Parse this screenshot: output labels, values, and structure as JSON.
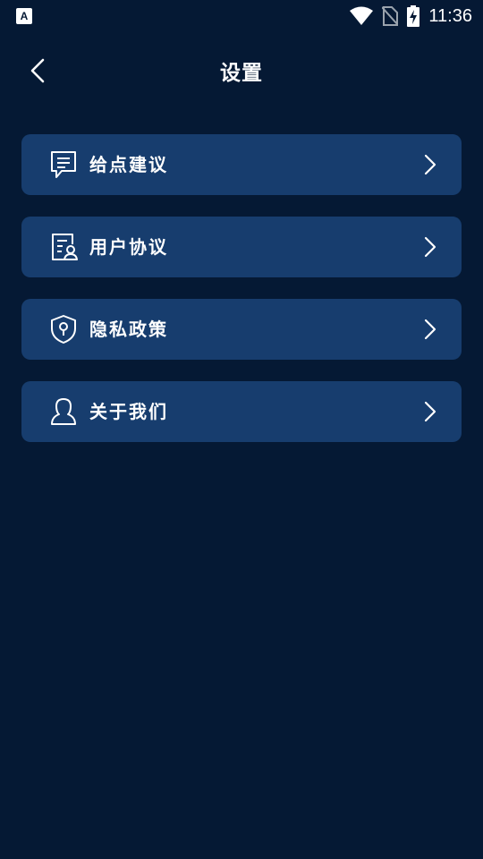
{
  "status_bar": {
    "app_badge": "A",
    "time": "11:36",
    "icons": [
      "wifi-icon",
      "no-sim-icon",
      "battery-charging-icon"
    ]
  },
  "header": {
    "title": "设置",
    "back_icon": "chevron-left-icon"
  },
  "menu": {
    "items": [
      {
        "label": "给点建议",
        "icon": "feedback-icon"
      },
      {
        "label": "用户协议",
        "icon": "user-agreement-icon"
      },
      {
        "label": "隐私政策",
        "icon": "privacy-shield-icon"
      },
      {
        "label": "关于我们",
        "icon": "person-icon"
      }
    ]
  },
  "colors": {
    "background": "#051934",
    "card": "#173d6e",
    "text": "#ffffff"
  }
}
